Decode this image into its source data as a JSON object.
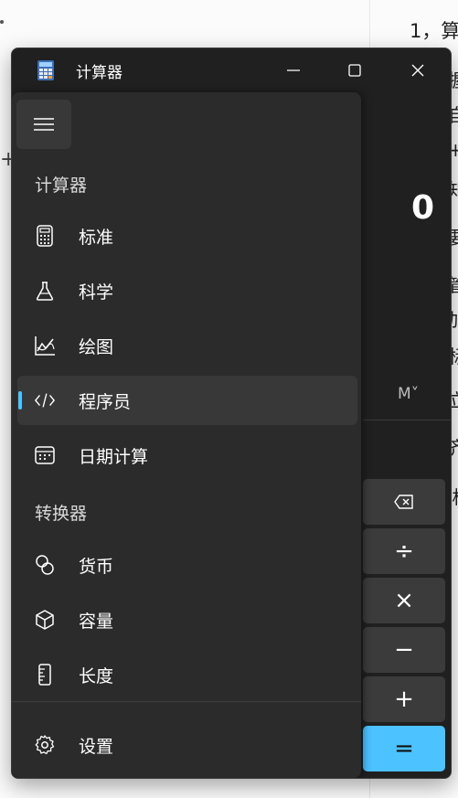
{
  "background_doc": {
    "top_text": "1，算",
    "lines": [
      "握",
      "自",
      "+",
      "知",
      "要",
      "管",
      "加",
      "标",
      "立",
      "齐",
      "·析"
    ]
  },
  "window": {
    "title": "计算器",
    "controls": {
      "minimize": "minimize",
      "maximize": "maximize",
      "close": "close"
    }
  },
  "display": {
    "value": "0",
    "memory_label": "M˅"
  },
  "operators": [
    "⌫",
    "÷",
    "×",
    "−",
    "+",
    "="
  ],
  "nav": {
    "calculator_section": "计算器",
    "calculator_items": [
      {
        "label": "标准",
        "icon": "calculator-icon"
      },
      {
        "label": "科学",
        "icon": "flask-icon"
      },
      {
        "label": "绘图",
        "icon": "graph-icon"
      },
      {
        "label": "程序员",
        "icon": "code-icon",
        "selected": true
      },
      {
        "label": "日期计算",
        "icon": "calendar-icon"
      }
    ],
    "converter_section": "转换器",
    "converter_items": [
      {
        "label": "货币",
        "icon": "currency-icon"
      },
      {
        "label": "容量",
        "icon": "cube-icon"
      },
      {
        "label": "长度",
        "icon": "ruler-icon"
      }
    ],
    "settings_label": "设置"
  },
  "colors": {
    "accent": "#4cc2ff",
    "pane": "#2b2b2b",
    "window": "#202020"
  }
}
